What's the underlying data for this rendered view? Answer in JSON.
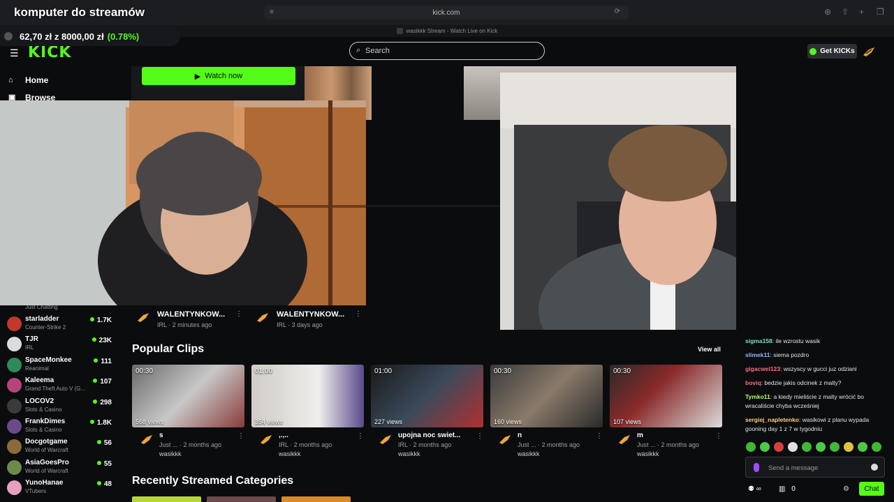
{
  "overlay": {
    "title": "komputer do streamów",
    "goal": {
      "current": "62,70 zł",
      "connector": "z",
      "target": "8000,00 zł",
      "percent": "(0.78%)",
      "progress": 0.0078
    }
  },
  "browser": {
    "url": "kick.com",
    "tab_title": "wasikkk Stream - Watch Live on Kick"
  },
  "header": {
    "logo": "KICK",
    "search_placeholder": "Search",
    "get_kicks": "Get KICKs"
  },
  "sidebar": {
    "nav": [
      {
        "label": "Home",
        "icon": "home-icon"
      },
      {
        "label": "Browse",
        "icon": "browse-icon"
      }
    ],
    "partial_category": "Just Chatting",
    "channels": [
      {
        "name": "starladder",
        "category": "Counter-Strike 2",
        "viewers": "1.7K",
        "color": "#c0392b"
      },
      {
        "name": "TJR",
        "category": "IRL",
        "viewers": "23K",
        "color": "#dcdcdc"
      },
      {
        "name": "SpaceMonkee",
        "category": "Reanimal",
        "viewers": "111",
        "color": "#2e8b57"
      },
      {
        "name": "Kaleema",
        "category": "Grand Theft Auto V (G...",
        "viewers": "107",
        "color": "#b4457a"
      },
      {
        "name": "LOCOV2",
        "category": "Slots & Casino",
        "viewers": "298",
        "color": "#3b3b3b"
      },
      {
        "name": "FrankDimes",
        "category": "Slots & Casino",
        "viewers": "1.8K",
        "color": "#6b4a8a"
      },
      {
        "name": "Docgotgame",
        "category": "World of Warcraft",
        "viewers": "56",
        "color": "#8a6a3a"
      },
      {
        "name": "AsiaGoesPro",
        "category": "World of Warcraft",
        "viewers": "55",
        "color": "#6c8a4a"
      },
      {
        "name": "YunoHanae",
        "category": "VTubers",
        "viewers": "48",
        "color": "#e8a0c0"
      }
    ]
  },
  "main": {
    "watch_now": "Watch now",
    "videos": [
      {
        "title": "WALENTYNKOW...",
        "sub": "IRL · 2 minutes ago"
      },
      {
        "title": "WALENTYNKOW...",
        "sub": "IRL · 3 days ago"
      }
    ],
    "popular_clips": {
      "heading": "Popular Clips",
      "view_all": "View all",
      "clips": [
        {
          "duration": "00:30",
          "views": "568 views",
          "title": "s",
          "sub": "Just ... · 2 months ago",
          "user": "wasikkk"
        },
        {
          "duration": "01:00",
          "views": "354 views",
          "title": ",.,..",
          "sub": "IRL · 2 months ago",
          "user": "wasikkk"
        },
        {
          "duration": "01:00",
          "views": "227 views",
          "title": "upojna noc swiet...",
          "sub": "IRL · 2 months ago",
          "user": "wasikkk"
        },
        {
          "duration": "00:30",
          "views": "160 views",
          "title": "n",
          "sub": "Just ... · 2 months ago",
          "user": "wasikkk"
        },
        {
          "duration": "00:30",
          "views": "107 views",
          "title": "m",
          "sub": "Just ... · 2 months ago",
          "user": "wasikkk"
        }
      ]
    },
    "recent_categories_heading": "Recently Streamed Categories"
  },
  "chat": {
    "messages": [
      {
        "user": "sigma158",
        "color": "#7ee0c8",
        "text": "ile wzrostu wasik"
      },
      {
        "user": "slimek11",
        "color": "#9bb4ff",
        "text": "siema pozdro"
      },
      {
        "user": "gigacwel123",
        "color": "#ff6b8b",
        "text": "wszyscy w gucci juz odziani"
      },
      {
        "user": "boviq",
        "color": "#ff6b8b",
        "text": "bedzie jakis odcinek z malty?"
      },
      {
        "user": "Tymko11",
        "color": "#b8ff6b",
        "text": "a kiedy mieliście z malty wrócić bo wracaliście chyba wcześniej"
      },
      {
        "user": "sergiej_napletenko",
        "color": "#ffd27a",
        "text": "wasikowi z planu wypada gooning day 1 z 7 w tygodniu"
      }
    ],
    "input_placeholder": "Send a message",
    "points": "∞",
    "gifts": "0",
    "chat_button": "Chat"
  }
}
